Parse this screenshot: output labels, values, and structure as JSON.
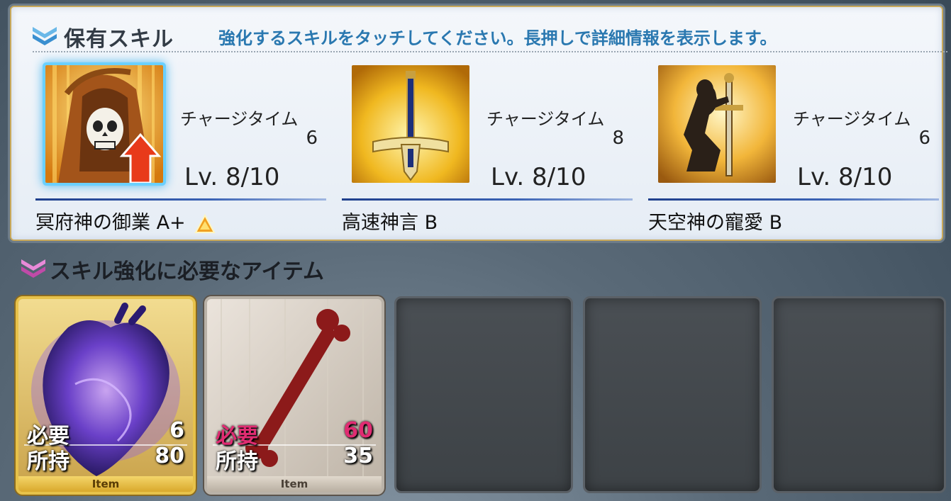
{
  "skills_panel": {
    "title": "保有スキル",
    "instruction": "強化するスキルをタッチしてください。長押しで詳細情報を表示します。"
  },
  "skills": [
    {
      "charge_label": "チャージタイム",
      "charge_value": "6",
      "level": "Lv. 8/10",
      "name": "冥府神の御業 A+",
      "icon": "reaper-skull-icon",
      "selected": true,
      "rank_up": true
    },
    {
      "charge_label": "チャージタイム",
      "charge_value": "8",
      "level": "Lv. 8/10",
      "name": "高速神言 B",
      "icon": "sword-icon",
      "selected": false,
      "rank_up": false
    },
    {
      "charge_label": "チャージタイム",
      "charge_value": "6",
      "level": "Lv. 8/10",
      "name": "天空神の寵愛 B",
      "icon": "kneeling-knight-icon",
      "selected": false,
      "rank_up": false
    }
  ],
  "items_panel": {
    "title": "スキル強化に必要なアイテム"
  },
  "items": [
    {
      "required_label": "必要",
      "required": "6",
      "owned_label": "所持",
      "owned": "80",
      "tag": "Item",
      "icon": "purple-heart-icon",
      "rarity": "gold",
      "insufficient": false
    },
    {
      "required_label": "必要",
      "required": "60",
      "owned_label": "所持",
      "owned": "35",
      "tag": "Item",
      "icon": "red-bone-icon",
      "rarity": "silver",
      "insufficient": true
    }
  ],
  "colors": {
    "instruction": "#2a78b0",
    "insufficient": "#e02c72",
    "selected_glow": "#6ad0ff"
  }
}
